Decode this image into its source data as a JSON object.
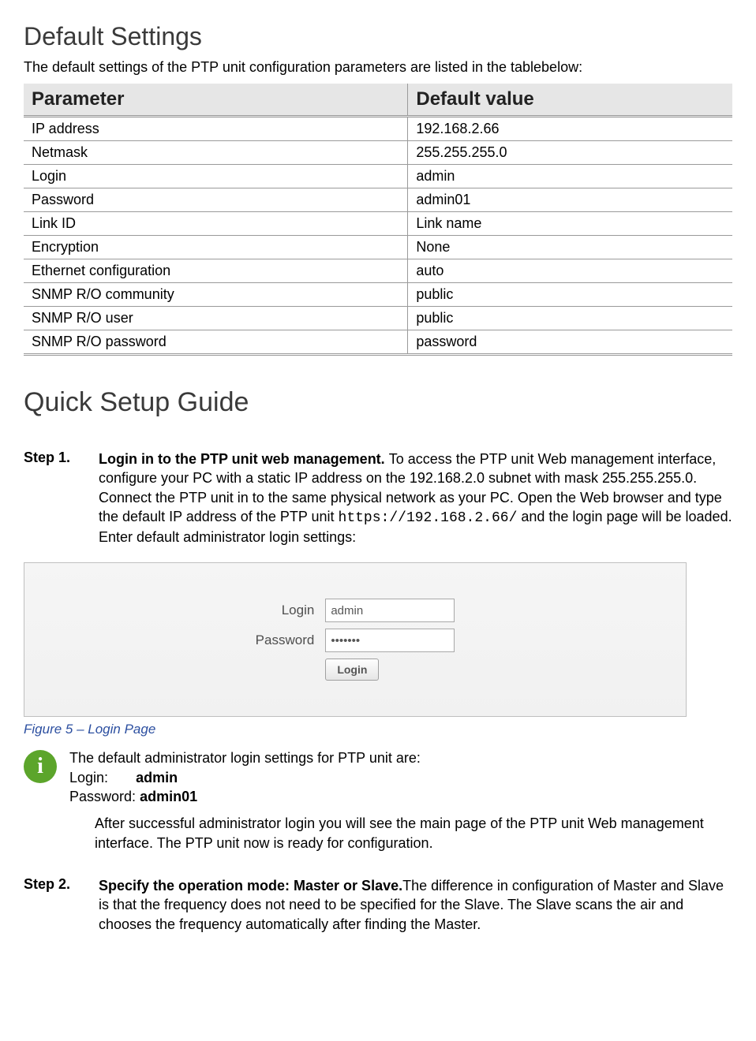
{
  "section1": {
    "title": "Default Settings",
    "intro": "The default settings of the PTP unit configuration parameters are listed in the tablebelow:",
    "table": {
      "headers": {
        "param": "Parameter",
        "value": "Default value"
      },
      "rows": [
        {
          "param": "IP address",
          "value": "192.168.2.66"
        },
        {
          "param": "Netmask",
          "value": "255.255.255.0"
        },
        {
          "param": "Login",
          "value": "admin"
        },
        {
          "param": "Password",
          "value": "admin01"
        },
        {
          "param": "Link ID",
          "value": "Link name"
        },
        {
          "param": "Encryption",
          "value": "None"
        },
        {
          "param": "Ethernet configuration",
          "value": "auto"
        },
        {
          "param": "SNMP R/O community",
          "value": "public"
        },
        {
          "param": "SNMP R/O user",
          "value": "public"
        },
        {
          "param": "SNMP R/O password",
          "value": "password"
        }
      ]
    }
  },
  "section2": {
    "title": "Quick Setup Guide",
    "step1": {
      "label": "Step 1.",
      "bold_lead": "Login in to the PTP unit web management. ",
      "text_a": "To access the PTP unit Web management interface, configure your PC with a static IP address on the 192.168.2.0 subnet with mask 255.255.255.0. Connect the PTP unit in to the same physical network as your PC. Open the Web browser and type the default IP address of the PTP unit ",
      "url": "https://192.168.2.66/",
      "text_b": " and the login page will be loaded. Enter default administrator login settings:"
    },
    "login_figure": {
      "login_label": "Login",
      "password_label": "Password",
      "login_value": "admin",
      "password_value": "*******",
      "button": "Login",
      "caption": "Figure 5 – Login Page"
    },
    "info": {
      "line1": "The default administrator login settings for PTP unit are:",
      "login_label": "Login:",
      "login_value": "admin",
      "password_label": "Password:",
      "password_value": "admin01"
    },
    "after_login": "After successful administrator login you will see the main page of the PTP unit Web management interface. The PTP unit now is ready for configuration.",
    "step2": {
      "label": "Step 2.",
      "bold_lead": "Specify the operation mode: Master or Slave.",
      "text": "The difference in configuration of Master and Slave is that the frequency does not need to be specified for the Slave. The Slave scans the air and chooses the frequency automatically after finding the Master."
    }
  }
}
